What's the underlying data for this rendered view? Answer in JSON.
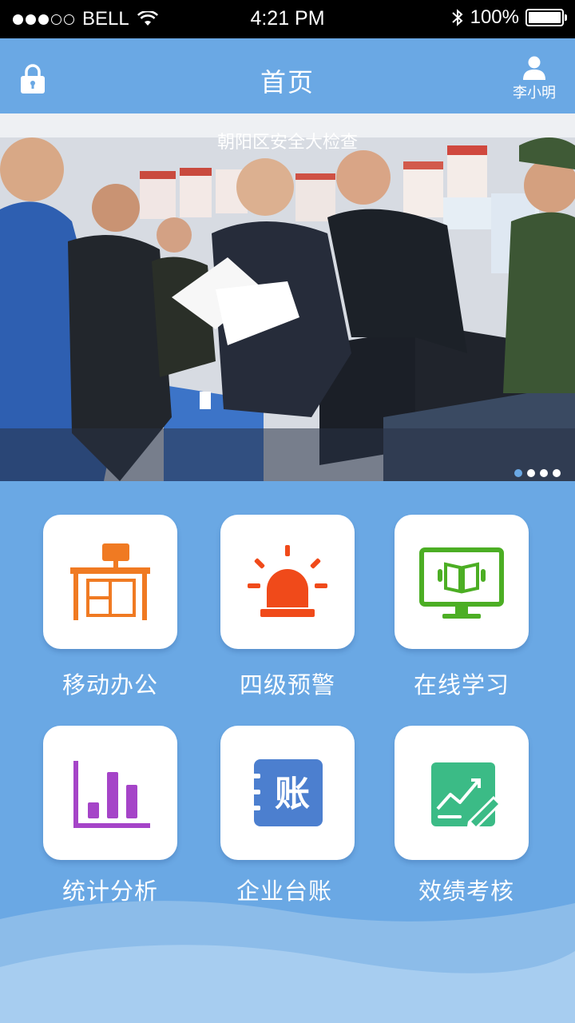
{
  "status_bar": {
    "carrier": "BELL",
    "time": "4:21 PM",
    "battery": "100%"
  },
  "nav": {
    "title": "首页",
    "user_name": "李小明"
  },
  "banner": {
    "caption": "朝阳区安全大检查",
    "page_count": 4,
    "active_page": 1
  },
  "menu": {
    "items": [
      {
        "label": "移动办公",
        "icon": "office-desk-icon",
        "color": "#f07a22"
      },
      {
        "label": "四级预警",
        "icon": "alarm-siren-icon",
        "color": "#f04a1a"
      },
      {
        "label": "在线学习",
        "icon": "online-learning-monitor-icon",
        "color": "#4cae24"
      },
      {
        "label": "统计分析",
        "icon": "bar-chart-icon",
        "color": "#a544c8"
      },
      {
        "label": "企业台账",
        "icon": "ledger-book-icon",
        "color": "#4c7fcf",
        "icon_text": "账"
      },
      {
        "label": "效绩考核",
        "icon": "performance-edit-icon",
        "color": "#3bbb86"
      }
    ]
  },
  "colors": {
    "primary": "#6aa8e4",
    "status_bar": "#000000"
  }
}
